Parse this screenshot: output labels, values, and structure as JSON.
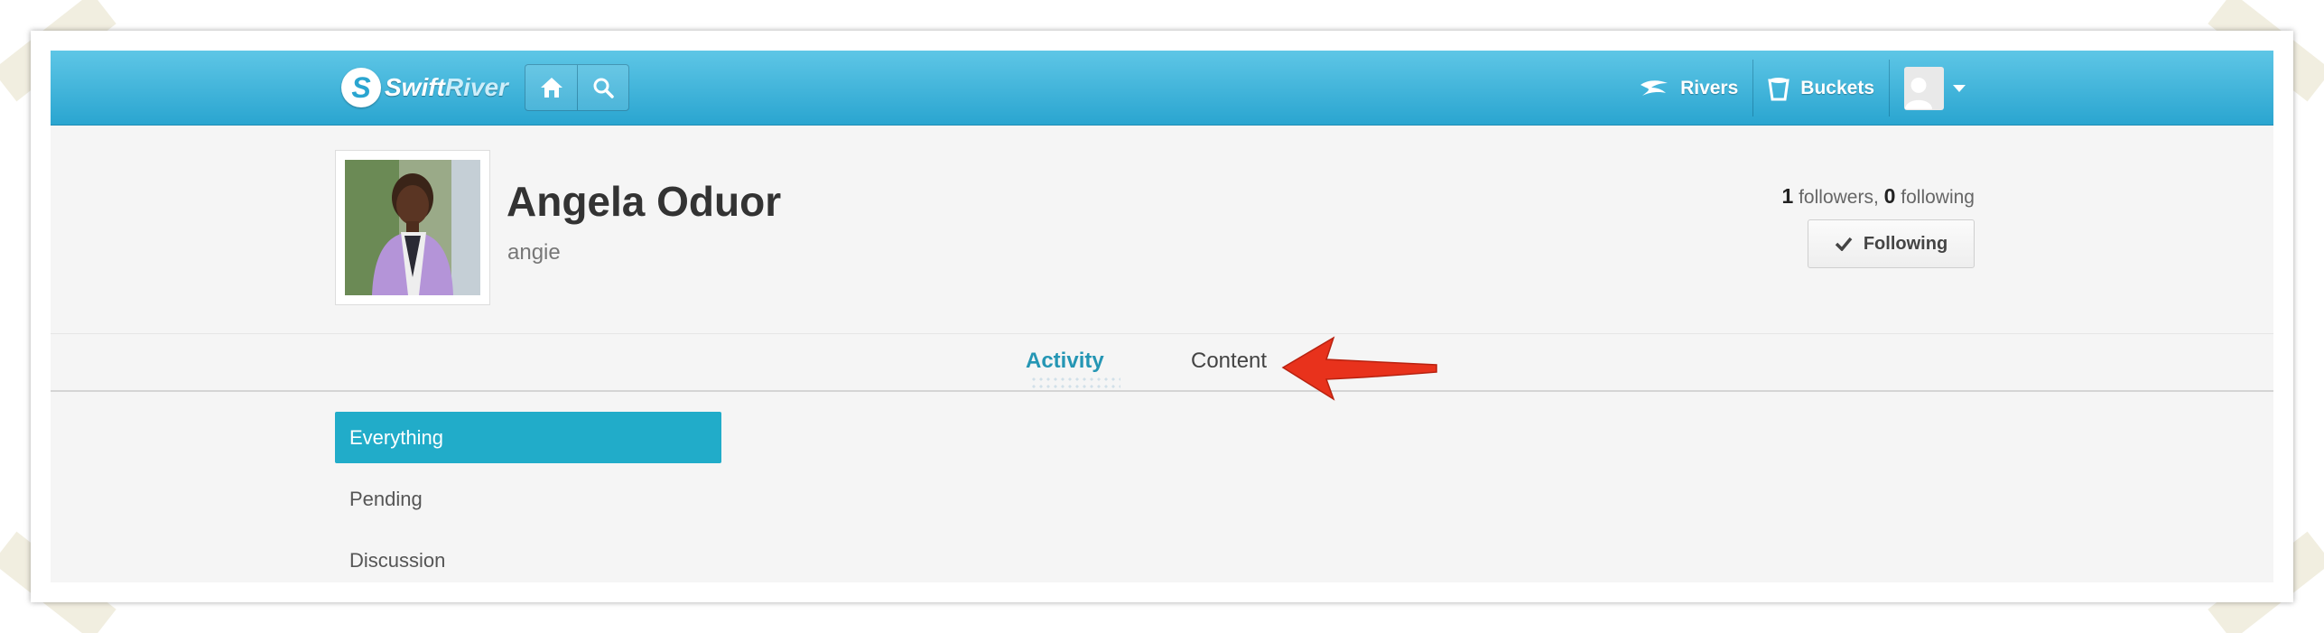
{
  "app": {
    "logo_text": "Swift",
    "logo_text_accent": "River"
  },
  "header": {
    "nav": [
      {
        "label": "Rivers",
        "icon": "river-icon"
      },
      {
        "label": "Buckets",
        "icon": "bucket-icon"
      }
    ]
  },
  "profile": {
    "name": "Angela Oduor",
    "username": "angie",
    "followers_count": "1",
    "followers_label": " followers, ",
    "following_count": "0",
    "following_label": " following",
    "follow_button_label": "Following"
  },
  "tabs": [
    {
      "label": "Activity",
      "active": true
    },
    {
      "label": "Content",
      "active": false
    }
  ],
  "sidebar": {
    "items": [
      {
        "label": "Everything",
        "active": true
      },
      {
        "label": "Pending",
        "active": false
      },
      {
        "label": "Discussion",
        "active": false
      }
    ]
  },
  "colors": {
    "header": "#2aa5d0",
    "accent": "#21acc9",
    "active_tab": "#2596b4",
    "annotation_arrow": "#e8321c"
  }
}
